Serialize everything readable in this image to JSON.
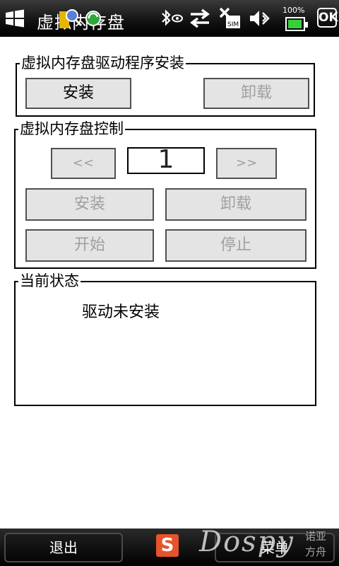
{
  "statusbar": {
    "title": "虚拟内存盘",
    "battery_pct": "100%",
    "battery_level": 0.95,
    "ok_label": "OK",
    "icons": [
      "windows-start-icon",
      "bluetooth-icon",
      "data-sync-icon",
      "no-sim-icon",
      "volume-off-icon",
      "battery-icon"
    ]
  },
  "install_group": {
    "legend": "虚拟内存盘驱动程序安装",
    "install_label": "安装",
    "uninstall_label": "卸载"
  },
  "control_group": {
    "legend": "虚拟内存盘控制",
    "prev_label": "<<",
    "number": "1",
    "next_label": ">>",
    "install_label": "安装",
    "uninstall_label": "卸载",
    "start_label": "开始",
    "stop_label": "停止"
  },
  "status_group": {
    "legend": "当前状态",
    "text": "驱动未安装"
  },
  "bottombar": {
    "exit_label": "退出",
    "menu_label": "菜单",
    "ime_icon": "S",
    "watermark": "Dospy",
    "watermark_cn_1": "诺亚",
    "watermark_cn_2": "方舟"
  }
}
